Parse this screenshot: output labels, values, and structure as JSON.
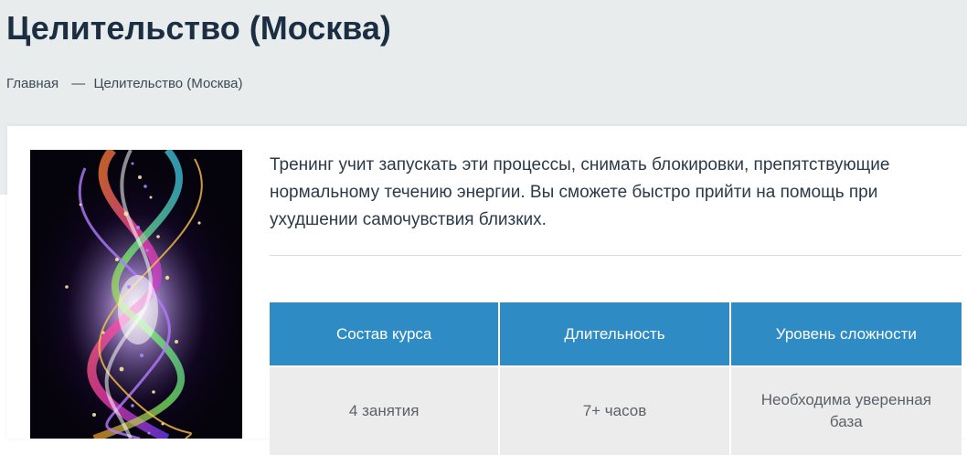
{
  "page": {
    "title": "Целительство (Москва)"
  },
  "breadcrumb": {
    "home": "Главная",
    "separator": "—",
    "current": "Целительство (Москва)"
  },
  "course": {
    "description": "Тренинг учит запускать эти процессы, снимать блокировки, препятствующие нормальному течению энергии. Вы сможете быстро прийти на помощь при ухудшении самочувствия близких.",
    "table": {
      "headers": [
        "Состав курса",
        "Длительность",
        "Уровень сложности"
      ],
      "values": [
        "4 занятия",
        "7+ часов",
        "Необходима уверенная база"
      ]
    }
  },
  "colors": {
    "header_bg": "#2f8bc4",
    "hero_bg": "#e8eced",
    "cell_bg": "#ececec",
    "title": "#1b2e42"
  }
}
